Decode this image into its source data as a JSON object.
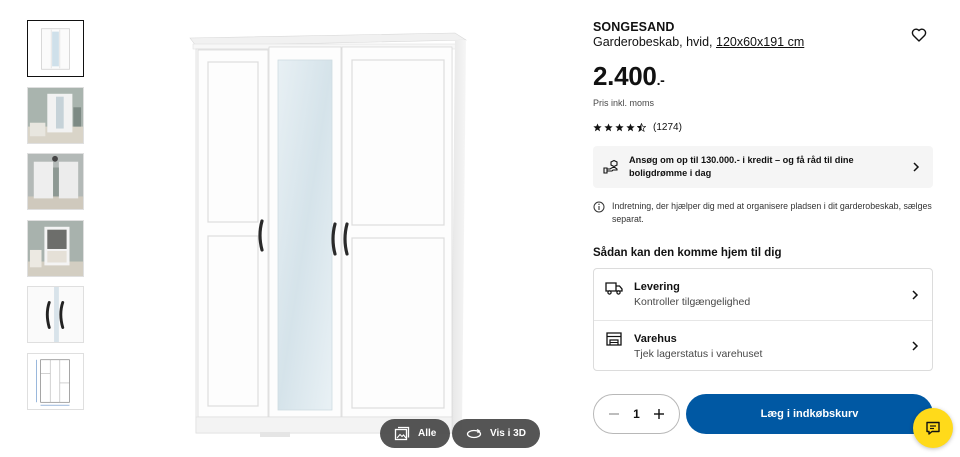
{
  "product": {
    "name": "SONGESAND",
    "desc_prefix": "Garderobeskab, hvid, ",
    "dimensions": "120x60x191 cm",
    "price_main": "2.400",
    "price_suffix": ".-",
    "price_note": "Pris inkl. moms",
    "rating_value": 4.5,
    "rating_count": "(1274)"
  },
  "credit": {
    "text": "Ansøg om op til 130.000.- i kredit – og få råd til dine boligdrømme i dag"
  },
  "info": {
    "text": "Indretning, der hjælper dig med at organisere pladsen i dit garderobeskab, sælges separat."
  },
  "delivery": {
    "title": "Sådan kan den komme hjem til dig",
    "rows": [
      {
        "icon": "truck-icon",
        "title": "Levering",
        "subtitle": "Kontroller tilgængelighed"
      },
      {
        "icon": "store-icon",
        "title": "Varehus",
        "subtitle": "Tjek lagerstatus i varehuset"
      }
    ]
  },
  "purchase": {
    "quantity": "1",
    "add_to_cart": "Læg i indkøbskurv"
  },
  "image_buttons": {
    "all": "Alle",
    "view_3d": "Vis i 3D"
  },
  "colors": {
    "accent_blue": "#0058a3",
    "chat_yellow": "#ffda1a"
  }
}
